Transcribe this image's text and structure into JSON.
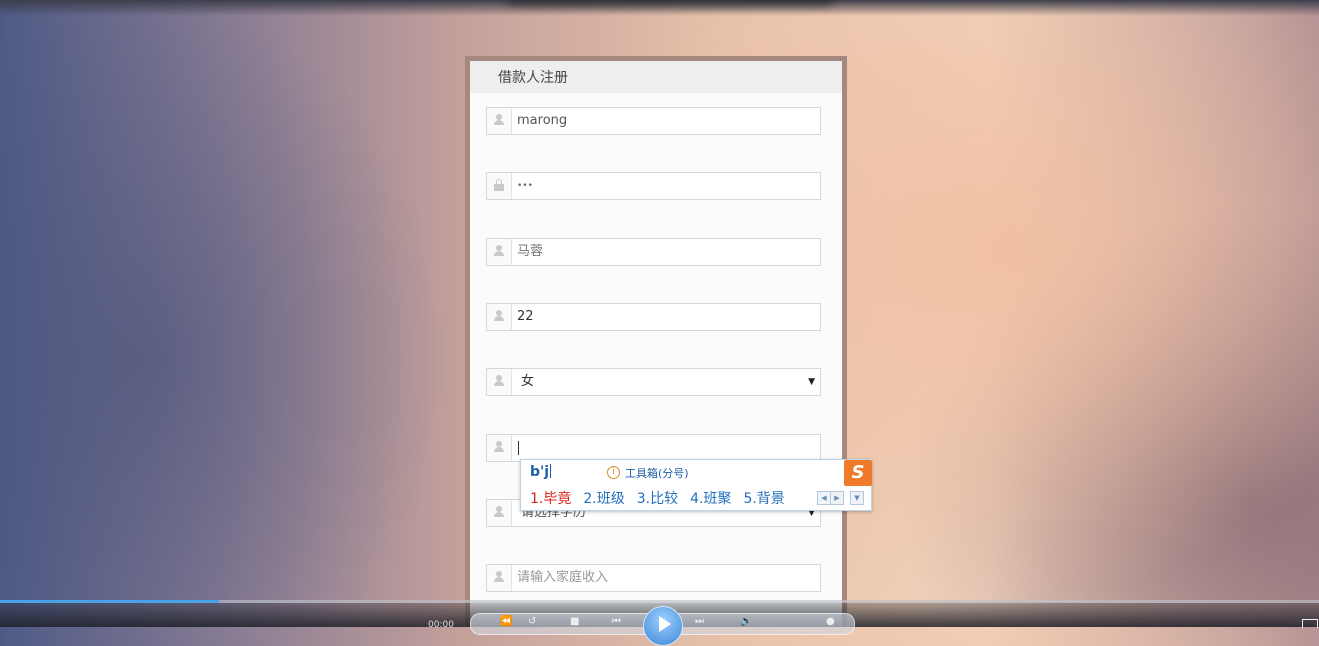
{
  "form": {
    "title": "借款人注册",
    "fields": [
      {
        "icon": "user-icon",
        "value": "marong",
        "placeholder": ""
      },
      {
        "icon": "lock-icon",
        "value": "•••",
        "placeholder": ""
      },
      {
        "icon": "user-icon",
        "value": "马蓉",
        "placeholder": ""
      },
      {
        "icon": "user-icon",
        "value": "22",
        "placeholder": ""
      },
      {
        "icon": "user-icon",
        "value": "女",
        "placeholder": ""
      },
      {
        "icon": "user-icon",
        "value": "",
        "placeholder": ""
      },
      {
        "icon": "user-icon",
        "value": "",
        "placeholder": "请选择学历"
      },
      {
        "icon": "user-icon",
        "value": "",
        "placeholder": "请输入家庭收入"
      }
    ]
  },
  "ime": {
    "composition": "b'j",
    "toolbox": "工具箱(分号)",
    "logo": "S",
    "candidates": [
      "1.毕竟",
      "2.班级",
      "3.比较",
      "4.班聚",
      "5.背景"
    ]
  },
  "player": {
    "progress_fraction": 0.166,
    "time": "00:00"
  },
  "colors": {
    "accent": "#4aa3e8",
    "ime_first": "#d8231b",
    "ime_other": "#2271c0",
    "ime_logo": "#f07a2a"
  }
}
